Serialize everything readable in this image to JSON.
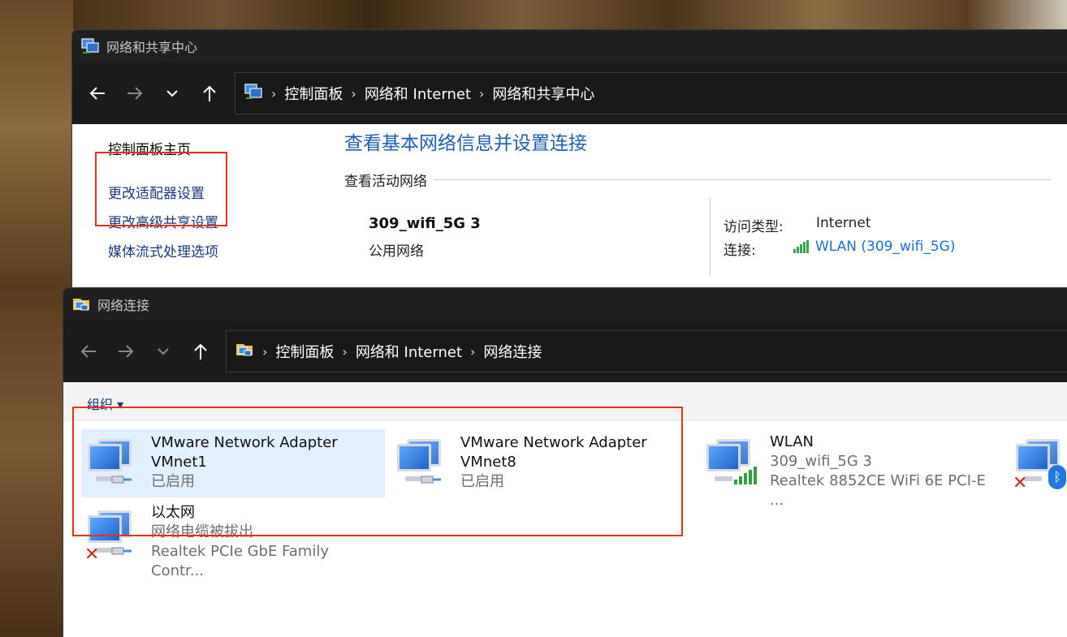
{
  "colors": {
    "accent": "#1e5fb0",
    "link": "#1e6fd0",
    "highlight": "#e0321e",
    "selected": "#e2efff"
  },
  "win1": {
    "title": "网络和共享中心",
    "breadcrumb": [
      "控制面板",
      "网络和 Internet",
      "网络和共享中心"
    ],
    "leftnav": [
      "控制面板主页",
      "更改适配器设置",
      "更改高级共享设置",
      "媒体流式处理选项"
    ],
    "headline": "查看基本网络信息并设置连接",
    "section": "查看活动网络",
    "network": {
      "name": "309_wifi_5G 3",
      "category": "公用网络"
    },
    "access_label": "访问类型:",
    "access_value": "Internet",
    "conn_label": "连接:",
    "conn_value": "WLAN (309_wifi_5G)"
  },
  "win2": {
    "title": "网络连接",
    "breadcrumb": [
      "控制面板",
      "网络和 Internet",
      "网络连接"
    ],
    "organize": "组织 ▾",
    "adapters": [
      {
        "name1": "VMware Network Adapter",
        "name2": "VMnet1",
        "status": "已启用"
      },
      {
        "name1": "VMware Network Adapter",
        "name2": "VMnet8",
        "status": "已启用"
      },
      {
        "name1": "WLAN",
        "status": "309_wifi_5G 3",
        "device": "Realtek 8852CE WiFi 6E PCI-E ..."
      },
      {
        "name1": "以太网",
        "status": "网络电缆被拔出",
        "device": "Realtek PCIe GbE Family Contr..."
      }
    ]
  },
  "icons": [
    "back-arrow-icon",
    "forward-arrow-icon",
    "chevron-down-icon",
    "up-arrow-icon",
    "network-icon",
    "wifi-bars-icon",
    "bluetooth-icon",
    "red-x-icon"
  ]
}
